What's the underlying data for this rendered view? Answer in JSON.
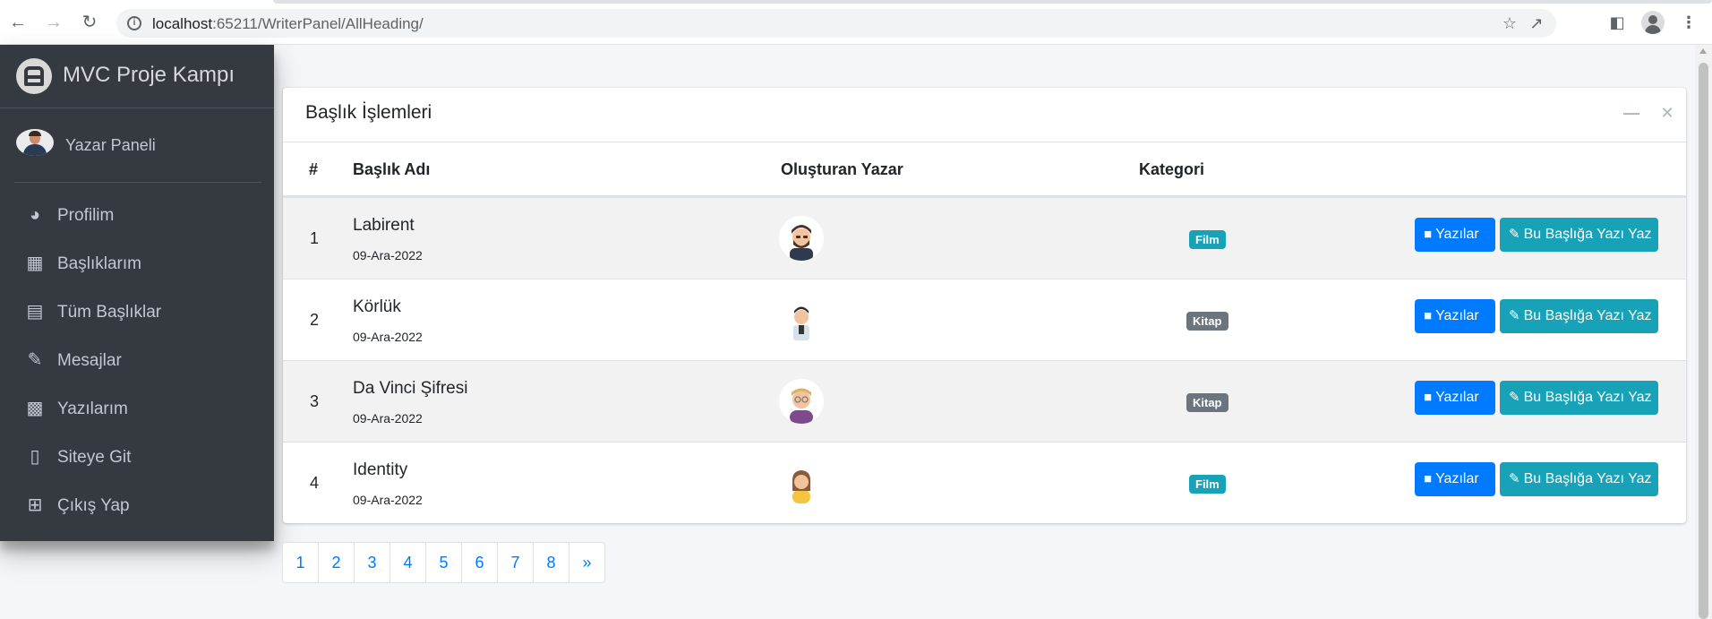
{
  "browser": {
    "url_host": "localhost",
    "url_rest": ":65211/WriterPanel/AllHeading/",
    "nav_icons": [
      "back-icon",
      "forward-icon",
      "reload-icon"
    ],
    "toolbar_icons": [
      "share-icon",
      "star-icon",
      "side-panel-icon",
      "profile-icon",
      "more-icon"
    ]
  },
  "sidebar": {
    "brand": "MVC Proje Kampı",
    "user": "Yazar Paneli",
    "items": [
      {
        "label": "Profilim",
        "icon": "dashboard-icon"
      },
      {
        "label": "Başlıklarım",
        "icon": "grid-icon"
      },
      {
        "label": "Tüm Başlıklar",
        "icon": "list-icon"
      },
      {
        "label": "Mesajlar",
        "icon": "edit-icon"
      },
      {
        "label": "Yazılarım",
        "icon": "calendar-icon"
      },
      {
        "label": "Siteye Git",
        "icon": "book-icon"
      },
      {
        "label": "Çıkış Yap",
        "icon": "plus-square-icon"
      }
    ]
  },
  "card": {
    "title": "Başlık İşlemleri",
    "headers": [
      "#",
      "Başlık Adı",
      "Oluşturan Yazar",
      "Kategori"
    ],
    "rows": [
      {
        "num": "1",
        "title": "Labirent",
        "date": "09-Ara-2022",
        "category": "Film",
        "category_color": "#17a2b8",
        "btn1": "Yazılar",
        "btn2": "Bu Başlığa Yazı Yaz"
      },
      {
        "num": "2",
        "title": "Körlük",
        "date": "09-Ara-2022",
        "category": "Kitap",
        "category_color": "#6c757d",
        "btn1": "Yazılar",
        "btn2": "Bu Başlığa Yazı Yaz"
      },
      {
        "num": "3",
        "title": "Da Vinci Şifresi",
        "date": "09-Ara-2022",
        "category": "Kitap",
        "category_color": "#6c757d",
        "btn1": "Yazılar",
        "btn2": "Bu Başlığa Yazı Yaz"
      },
      {
        "num": "4",
        "title": "Identity",
        "date": "09-Ara-2022",
        "category": "Film",
        "category_color": "#17a2b8",
        "btn1": "Yazılar",
        "btn2": "Bu Başlığa Yazı Yaz"
      }
    ]
  },
  "pagination": [
    "1",
    "2",
    "3",
    "4",
    "5",
    "6",
    "7",
    "8",
    "»"
  ]
}
